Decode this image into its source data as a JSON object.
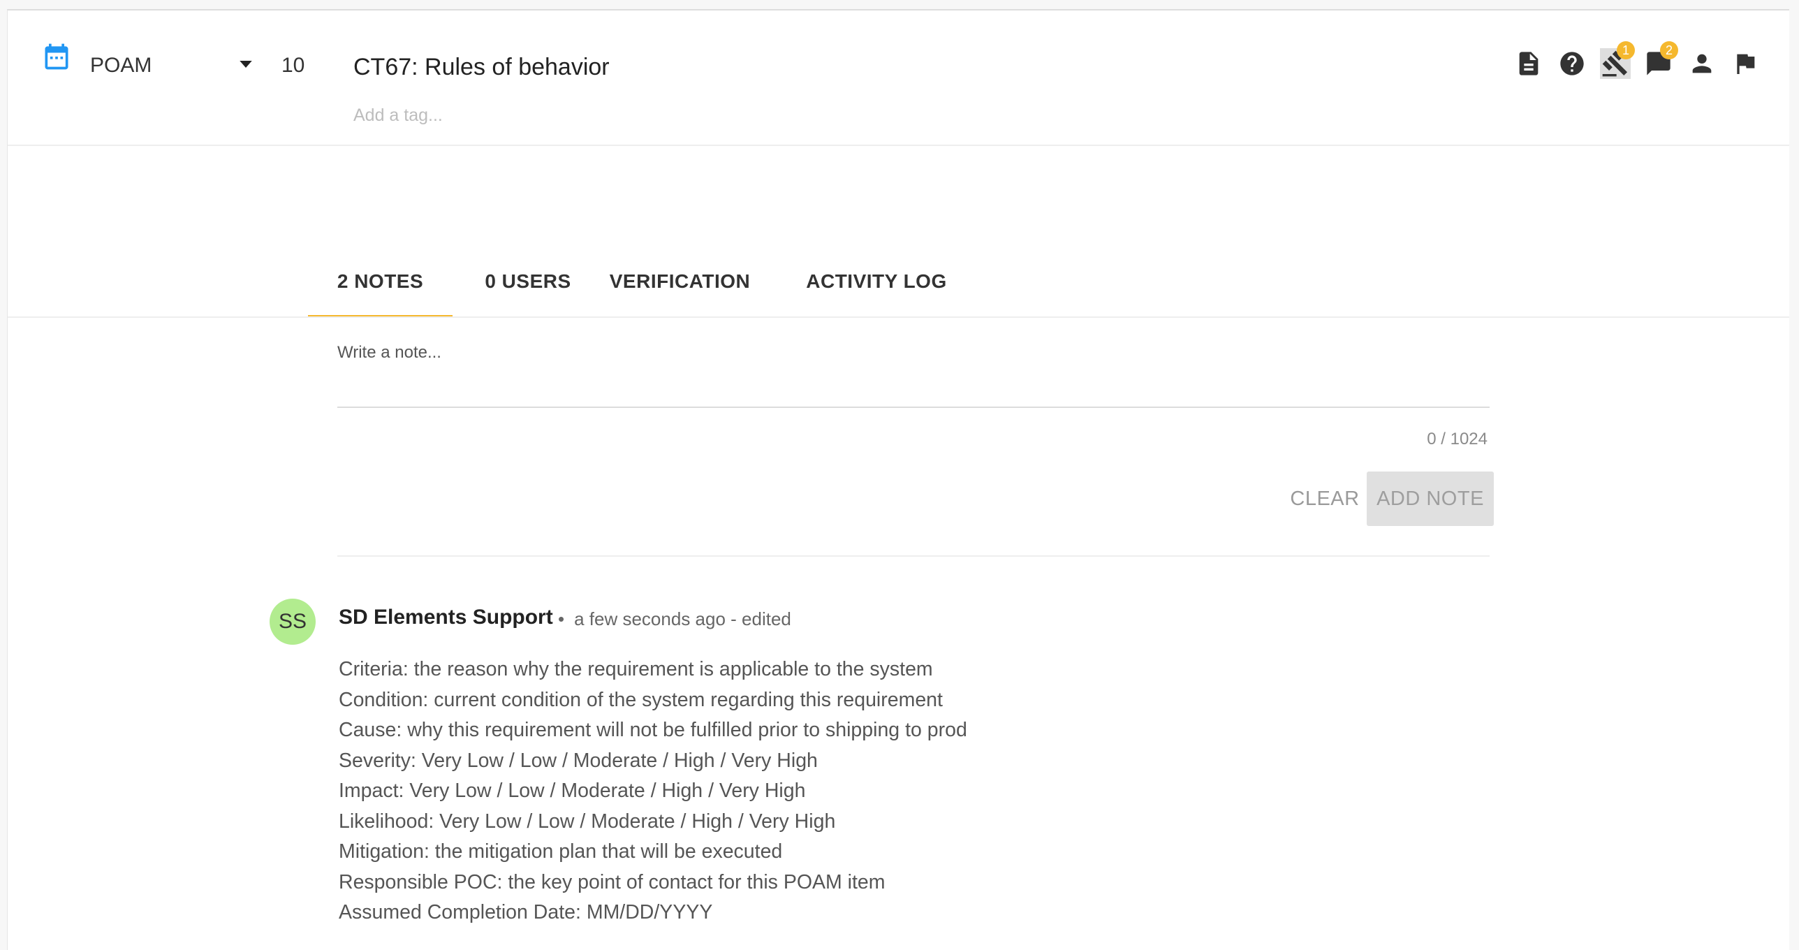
{
  "header": {
    "phase": "POAM",
    "priority": "10",
    "title": "CT67: Rules of behavior",
    "tag_placeholder": "Add a tag...",
    "icons": [
      {
        "name": "document-icon"
      },
      {
        "name": "help-icon"
      },
      {
        "name": "gavel-icon",
        "badge": "1",
        "active": true
      },
      {
        "name": "comment-icon",
        "badge": "2"
      },
      {
        "name": "person-icon"
      },
      {
        "name": "flag-icon"
      }
    ]
  },
  "tabs": [
    {
      "label": "2 NOTES",
      "active": true
    },
    {
      "label": "0 USERS"
    },
    {
      "label": "VERIFICATION"
    },
    {
      "label": "ACTIVITY LOG"
    }
  ],
  "composer": {
    "placeholder": "Write a note...",
    "counter": "0 / 1024",
    "clear_label": "CLEAR",
    "add_label": "ADD NOTE"
  },
  "note": {
    "initials": "SS",
    "author": "SD Elements Support",
    "separator": "•",
    "meta": "a few seconds ago - edited",
    "lines": [
      "Criteria: the reason why the requirement is applicable to the system",
      "Condition: current condition of the system regarding this requirement",
      "Cause: why this requirement will not be fulfilled prior to shipping to prod",
      "Severity: Very Low / Low / Moderate / High / Very High",
      "Impact: Very Low / Low / Moderate / High / Very High",
      "Likelihood: Very Low / Low / Moderate / High / Very High",
      "Mitigation: the mitigation plan that will be executed",
      "Responsible POC: the key point of contact for this POAM item",
      "Assumed Completion Date: MM/DD/YYYY"
    ]
  },
  "colors": {
    "accent": "#f5b82e",
    "calendar_icon": "#2196f3",
    "avatar_bg": "#b2ec8f"
  }
}
